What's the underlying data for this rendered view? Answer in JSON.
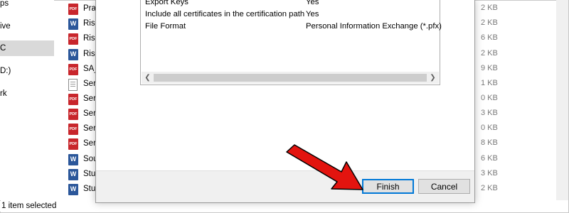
{
  "nav": {
    "items": [
      {
        "label": "ps",
        "selected": false
      },
      {
        "label": "ive",
        "selected": false
      },
      {
        "label": "C",
        "selected": true
      },
      {
        "label": "D:)",
        "selected": false
      },
      {
        "label": "rk",
        "selected": false
      }
    ]
  },
  "files": [
    {
      "type": "pdf-icon",
      "name": "Pra"
    },
    {
      "type": "word-icon",
      "name": "Ris"
    },
    {
      "type": "pdf-icon",
      "name": "Ris"
    },
    {
      "type": "word-icon",
      "name": "Ris"
    },
    {
      "type": "pdf-icon",
      "name": "SA_"
    },
    {
      "type": "text-file-icon",
      "name": "Ser"
    },
    {
      "type": "pdf-icon",
      "name": "Ser"
    },
    {
      "type": "pdf-icon",
      "name": "Ser"
    },
    {
      "type": "pdf-icon",
      "name": "Ser"
    },
    {
      "type": "pdf-icon",
      "name": "Ser"
    },
    {
      "type": "word-icon",
      "name": "Sou"
    },
    {
      "type": "word-icon",
      "name": "Stu"
    },
    {
      "type": "word-icon",
      "name": "Stu"
    }
  ],
  "sizes": [
    "2 KB",
    "2 KB",
    "6 KB",
    "2 KB",
    "9 KB",
    "1 KB",
    "0 KB",
    "3 KB",
    "0 KB",
    "8 KB",
    "6 KB",
    "3 KB",
    "2 KB"
  ],
  "status": {
    "text": "1 item selected"
  },
  "dialog": {
    "properties": [
      {
        "key": "Export Keys",
        "value": "Yes"
      },
      {
        "key": "Include all certificates in the certification path",
        "value": "Yes"
      },
      {
        "key": "File Format",
        "value": "Personal Information Exchange (*.pfx)"
      }
    ],
    "finish_label": "Finish",
    "cancel_label": "Cancel"
  },
  "colors": {
    "accent": "#0078d7",
    "arrow_red": "#e3140f",
    "pdf_red": "#c8262c",
    "word_blue": "#2b579a"
  }
}
